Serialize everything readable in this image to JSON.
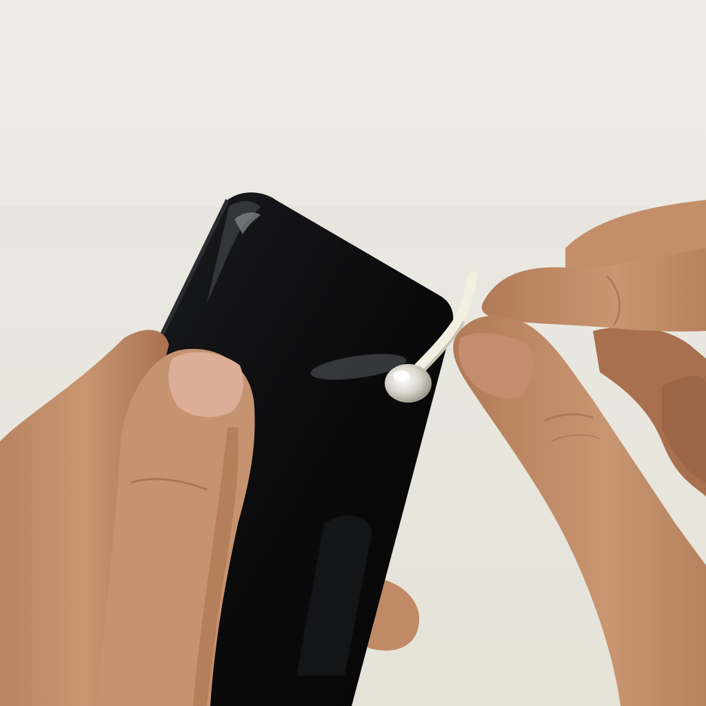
{
  "scene": {
    "subject": "hands-cleaning-phone-speaker-with-cotton-swab",
    "colors": {
      "background_top": "#ecebe6",
      "background_bottom": "#e5e3d8",
      "skin": "#c79470",
      "skin_shadow": "#9c6a4c",
      "skin_highlight": "#dbb18f",
      "nail": "#dcae98",
      "phone_body": "#0b0b0c",
      "phone_edge": "#2b2c30",
      "phone_reflection": "#5a5c62",
      "swab_stick": "#f3f0e2",
      "swab_tip": "#d8d6cc"
    }
  }
}
